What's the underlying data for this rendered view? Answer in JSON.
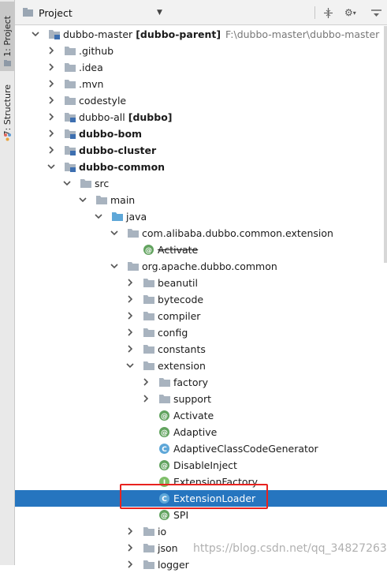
{
  "side_tabs": [
    {
      "label": "1: Project",
      "icon": "project-folder-icon",
      "active": true
    },
    {
      "label": "7: Structure",
      "icon": "structure-icon",
      "active": false
    }
  ],
  "header": {
    "title": "Project",
    "dropdown_icon": "chevron-down-icon",
    "actions": [
      "globe-icon",
      "collapse-all-icon",
      "gear-icon",
      "hide-icon"
    ]
  },
  "tree": [
    {
      "depth": 0,
      "expand": "open",
      "icon": "module",
      "label": "dubbo-master",
      "bold_suffix": "[dubbo-parent]",
      "hint": "F:\\dubbo-master\\dubbo-master"
    },
    {
      "depth": 1,
      "expand": "closed",
      "icon": "folder",
      "label": ".github"
    },
    {
      "depth": 1,
      "expand": "closed",
      "icon": "folder",
      "label": ".idea"
    },
    {
      "depth": 1,
      "expand": "closed",
      "icon": "folder",
      "label": ".mvn"
    },
    {
      "depth": 1,
      "expand": "closed",
      "icon": "folder",
      "label": "codestyle"
    },
    {
      "depth": 1,
      "expand": "closed",
      "icon": "module",
      "label": "dubbo-all",
      "bold_suffix": "[dubbo]"
    },
    {
      "depth": 1,
      "expand": "closed",
      "icon": "module",
      "label": "dubbo-bom",
      "bold": true
    },
    {
      "depth": 1,
      "expand": "closed",
      "icon": "module",
      "label": "dubbo-cluster",
      "bold": true
    },
    {
      "depth": 1,
      "expand": "open",
      "icon": "module",
      "label": "dubbo-common",
      "bold": true
    },
    {
      "depth": 2,
      "expand": "open",
      "icon": "folder",
      "label": "src"
    },
    {
      "depth": 3,
      "expand": "open",
      "icon": "folder",
      "label": "main"
    },
    {
      "depth": 4,
      "expand": "open",
      "icon": "srcfolder",
      "label": "java"
    },
    {
      "depth": 5,
      "expand": "open",
      "icon": "folder",
      "label": "com.alibaba.dubbo.common.extension"
    },
    {
      "depth": 6,
      "expand": "none",
      "icon": "annotation",
      "label": "Activate",
      "strike": true
    },
    {
      "depth": 5,
      "expand": "open",
      "icon": "folder",
      "label": "org.apache.dubbo.common"
    },
    {
      "depth": 6,
      "expand": "closed",
      "icon": "folder",
      "label": "beanutil"
    },
    {
      "depth": 6,
      "expand": "closed",
      "icon": "folder",
      "label": "bytecode"
    },
    {
      "depth": 6,
      "expand": "closed",
      "icon": "folder",
      "label": "compiler"
    },
    {
      "depth": 6,
      "expand": "closed",
      "icon": "folder",
      "label": "config"
    },
    {
      "depth": 6,
      "expand": "closed",
      "icon": "folder",
      "label": "constants"
    },
    {
      "depth": 6,
      "expand": "open",
      "icon": "folder",
      "label": "extension"
    },
    {
      "depth": 7,
      "expand": "closed",
      "icon": "folder",
      "label": "factory"
    },
    {
      "depth": 7,
      "expand": "closed",
      "icon": "folder",
      "label": "support"
    },
    {
      "depth": 7,
      "expand": "none",
      "icon": "annotation",
      "label": "Activate"
    },
    {
      "depth": 7,
      "expand": "none",
      "icon": "annotation",
      "label": "Adaptive"
    },
    {
      "depth": 7,
      "expand": "none",
      "icon": "class",
      "label": "AdaptiveClassCodeGenerator"
    },
    {
      "depth": 7,
      "expand": "none",
      "icon": "annotation",
      "label": "DisableInject"
    },
    {
      "depth": 7,
      "expand": "none",
      "icon": "interface",
      "label": "ExtensionFactory"
    },
    {
      "depth": 7,
      "expand": "none",
      "icon": "class",
      "label": "ExtensionLoader",
      "selected": true
    },
    {
      "depth": 7,
      "expand": "none",
      "icon": "annotation",
      "label": "SPI"
    },
    {
      "depth": 6,
      "expand": "closed",
      "icon": "folder",
      "label": "io"
    },
    {
      "depth": 6,
      "expand": "closed",
      "icon": "folder",
      "label": "json"
    },
    {
      "depth": 6,
      "expand": "closed",
      "icon": "folder",
      "label": "logger"
    }
  ],
  "watermark": "https://blog.csdn.net/qq_34827263",
  "colors": {
    "selection": "#2675bf",
    "highlight_box": "#e8231f",
    "folder": "#a8b3bf",
    "class_icon": "#5ea7d8",
    "annotation_icon": "#62a35f",
    "interface_icon": "#7fbf6a"
  }
}
